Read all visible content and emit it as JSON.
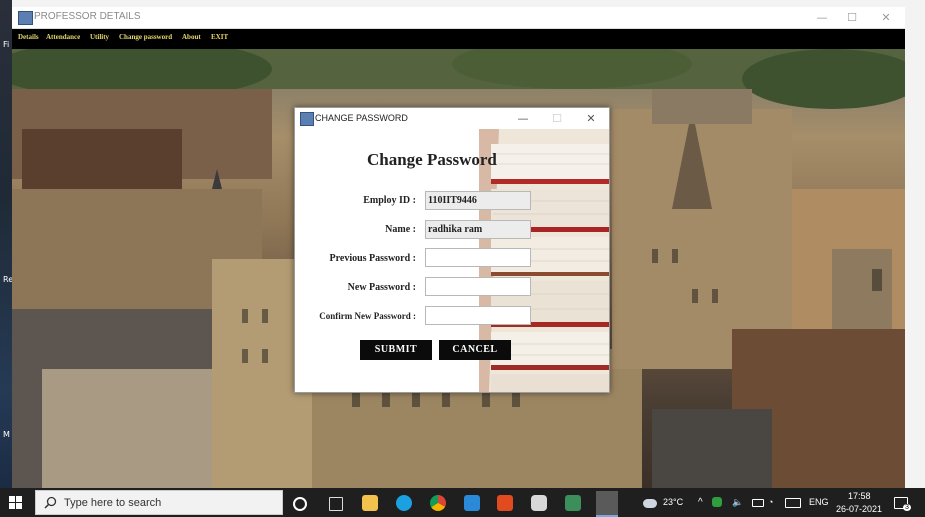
{
  "main_window": {
    "title": "PROFESSOR DETAILS",
    "controls": {
      "minimize": "—",
      "maximize": "☐",
      "close": "✕"
    },
    "menu": [
      "Details",
      "Attendance",
      "Utility",
      "Change password",
      "About",
      "EXIT"
    ]
  },
  "dialog": {
    "title": "CHANGE PASSWORD",
    "controls": {
      "minimize": "—",
      "maximize": "☐",
      "close": "✕"
    },
    "heading": "Change Password",
    "fields": [
      {
        "label": "Employ ID :",
        "value": "110IIT9446",
        "readonly": true
      },
      {
        "label": "Name :",
        "value": "radhika ram",
        "readonly": true
      },
      {
        "label": "Previous Password :",
        "value": "",
        "readonly": false
      },
      {
        "label": "New Password :",
        "value": "",
        "readonly": false
      },
      {
        "label": "Confirm New Password :",
        "value": "",
        "readonly": false
      }
    ],
    "submit_label": "SUBMIT",
    "cancel_label": "CANCEL"
  },
  "taskbar": {
    "search_placeholder": "Type here to search",
    "weather": "23°C",
    "language": "ENG",
    "time": "17:58",
    "date": "26-07-2021",
    "notifications": "3",
    "icons": [
      "cortana-icon",
      "task-view-icon",
      "file-explorer-icon",
      "edge-icon",
      "chrome-icon",
      "vscode-icon",
      "office-icon",
      "cube-app-icon",
      "terminal-icon",
      "java-app-icon"
    ]
  },
  "desktop_side_marks": [
    "Fi",
    "Re",
    "M"
  ],
  "colors": {
    "menu_text": "#e6d96a",
    "button_bg": "#0b0b0b",
    "taskbar_bg": "#1f1f1f"
  }
}
